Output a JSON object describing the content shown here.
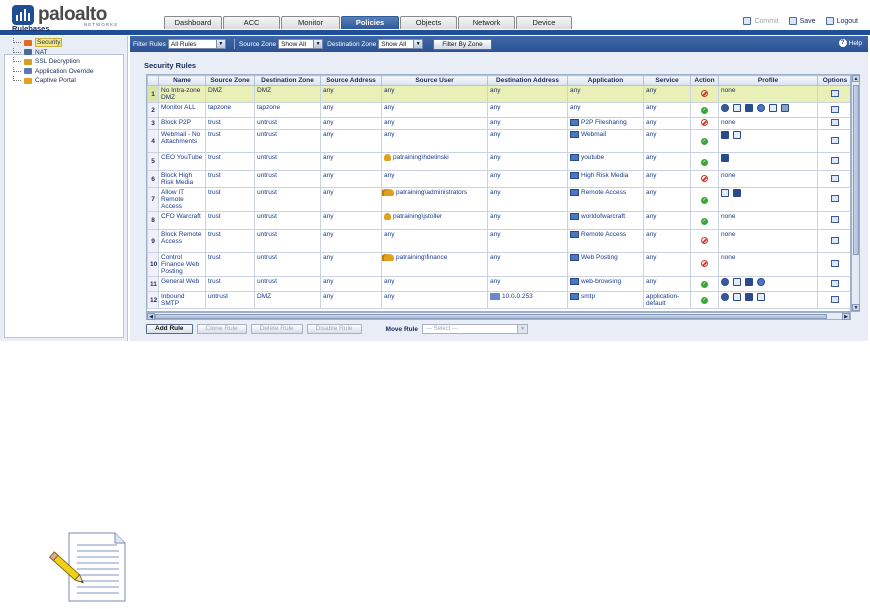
{
  "app": {
    "logo_text": "paloalto",
    "logo_subtext": "NETWORKS"
  },
  "tabs": [
    {
      "label": "Dashboard",
      "active": false
    },
    {
      "label": "ACC",
      "active": false
    },
    {
      "label": "Monitor",
      "active": false
    },
    {
      "label": "Policies",
      "active": true
    },
    {
      "label": "Objects",
      "active": false
    },
    {
      "label": "Network",
      "active": false
    },
    {
      "label": "Device",
      "active": false
    }
  ],
  "header_actions": {
    "commit": "Commit",
    "save": "Save",
    "logout": "Logout"
  },
  "filter_bar": {
    "filter_rules_label": "Filter Rules",
    "filter_rules_value": "All Rules",
    "source_zone_label": "Source Zone",
    "source_zone_value": "Show All",
    "destination_zone_label": "Destination Zone",
    "destination_zone_value": "Show All",
    "filter_button": "Filter By Zone",
    "help": "Help"
  },
  "sidebar": {
    "title": "Rulebases",
    "items": [
      {
        "label": "Security",
        "icon": "security-icon",
        "selected": true
      },
      {
        "label": "NAT",
        "icon": "nat-icon",
        "selected": false
      },
      {
        "label": "SSL Decryption",
        "icon": "ssl-icon",
        "selected": false
      },
      {
        "label": "Application Override",
        "icon": "app-override-icon",
        "selected": false
      },
      {
        "label": "Captive Portal",
        "icon": "captive-portal-icon",
        "selected": false
      }
    ]
  },
  "rules": {
    "title": "Security Rules",
    "columns": [
      "",
      "Name",
      "Source Zone",
      "Destination Zone",
      "Source Address",
      "Source User",
      "Destination Address",
      "Application",
      "Service",
      "Action",
      "Profile",
      "Options"
    ],
    "rows": [
      {
        "num": "1",
        "name": "No Intra-zone DMZ",
        "src_zone": "DMZ",
        "dst_zone": "DMZ",
        "src_addr": "any",
        "user": "any",
        "user_icon": "",
        "dst_addr": "any",
        "app": "any",
        "app_icon": false,
        "service": "any",
        "action": "deny",
        "profile_text": "none",
        "profiles": [],
        "highlight": true
      },
      {
        "num": "2",
        "name": "Monitor ALL",
        "src_zone": "tapzone",
        "dst_zone": "tapzone",
        "src_addr": "any",
        "user": "any",
        "user_icon": "",
        "dst_addr": "any",
        "app": "any",
        "app_icon": false,
        "service": "any",
        "action": "allow",
        "profile_text": "",
        "profiles": [
          "p1",
          "p2",
          "p3",
          "p4",
          "p5",
          "p6"
        ],
        "highlight": false
      },
      {
        "num": "3",
        "name": "Block P2P",
        "src_zone": "trust",
        "dst_zone": "untrust",
        "src_addr": "any",
        "user": "any",
        "user_icon": "",
        "dst_addr": "any",
        "app": "P2P Filesharing",
        "app_icon": true,
        "service": "any",
        "action": "deny",
        "profile_text": "none",
        "profiles": [],
        "highlight": false
      },
      {
        "num": "4",
        "name": "Webmail - No Attachments",
        "src_zone": "trust",
        "dst_zone": "untrust",
        "src_addr": "any",
        "user": "any",
        "user_icon": "",
        "dst_addr": "any",
        "app": "Webmail",
        "app_icon": true,
        "service": "any",
        "action": "allow",
        "profile_text": "",
        "profiles": [
          "p3",
          "p2"
        ],
        "highlight": false
      },
      {
        "num": "5",
        "name": "CEO YouTube",
        "src_zone": "trust",
        "dst_zone": "untrust",
        "src_addr": "any",
        "user": "patraining\\hdelinski",
        "user_icon": "user",
        "dst_addr": "any",
        "app": "youtube",
        "app_icon": true,
        "service": "any",
        "action": "allow",
        "profile_text": "",
        "profiles": [
          "p3"
        ],
        "highlight": false
      },
      {
        "num": "6",
        "name": "Block High Risk Media",
        "src_zone": "trust",
        "dst_zone": "untrust",
        "src_addr": "any",
        "user": "any",
        "user_icon": "",
        "dst_addr": "any",
        "app": "High Risk Media",
        "app_icon": true,
        "service": "any",
        "action": "deny",
        "profile_text": "none",
        "profiles": [],
        "highlight": false
      },
      {
        "num": "7",
        "name": "Allow IT Remote Access",
        "src_zone": "trust",
        "dst_zone": "untrust",
        "src_addr": "any",
        "user": "patraining\\administrators",
        "user_icon": "group",
        "dst_addr": "any",
        "app": "Remote Access",
        "app_icon": true,
        "service": "any",
        "action": "allow",
        "profile_text": "",
        "profiles": [
          "p2",
          "p3"
        ],
        "highlight": false
      },
      {
        "num": "8",
        "name": "CFO Warcraft",
        "src_zone": "trust",
        "dst_zone": "untrust",
        "src_addr": "any",
        "user": "patraining\\jstoller",
        "user_icon": "user",
        "dst_addr": "any",
        "app": "worldofwarcraft",
        "app_icon": true,
        "service": "any",
        "action": "allow",
        "profile_text": "none",
        "profiles": [],
        "highlight": false
      },
      {
        "num": "9",
        "name": "Block Remote Access",
        "src_zone": "trust",
        "dst_zone": "untrust",
        "src_addr": "any",
        "user": "any",
        "user_icon": "",
        "dst_addr": "any",
        "app": "Remote Access",
        "app_icon": true,
        "service": "any",
        "action": "deny",
        "profile_text": "none",
        "profiles": [],
        "highlight": false
      },
      {
        "num": "10",
        "name": "Control Finance Web Posting",
        "src_zone": "trust",
        "dst_zone": "untrust",
        "src_addr": "any",
        "user": "patraining\\finance",
        "user_icon": "group",
        "dst_addr": "any",
        "app": "Web Posting",
        "app_icon": true,
        "service": "any",
        "action": "deny",
        "profile_text": "none",
        "profiles": [],
        "highlight": false
      },
      {
        "num": "11",
        "name": "General Web",
        "src_zone": "trust",
        "dst_zone": "untrust",
        "src_addr": "any",
        "user": "any",
        "user_icon": "",
        "dst_addr": "any",
        "app": "web-browsing",
        "app_icon": true,
        "service": "any",
        "action": "allow",
        "profile_text": "",
        "profiles": [
          "p1",
          "p2",
          "p3",
          "p4"
        ],
        "highlight": false
      },
      {
        "num": "12",
        "name": "Inbound SMTP",
        "src_zone": "untrust",
        "dst_zone": "DMZ",
        "src_addr": "any",
        "user": "any",
        "user_icon": "",
        "dst_addr": "10.0.0.253",
        "dst_icon": true,
        "app": "smtp",
        "app_icon": true,
        "service": "application-default",
        "action": "allow",
        "profile_text": "",
        "profiles": [
          "p1",
          "p2",
          "p3",
          "p5"
        ],
        "highlight": false
      }
    ]
  },
  "bottom_bar": {
    "add": "Add Rule",
    "clone": "Clone Rule",
    "delete": "Delete Rule",
    "disable": "Disable Rule",
    "move_label": "Move Rule",
    "move_placeholder": "--- Select ---"
  },
  "colors": {
    "brand_blue": "#1f4e96",
    "allow": "#3aa63a",
    "deny": "#d03a2a",
    "highlight_row": "#e8f0b8"
  }
}
